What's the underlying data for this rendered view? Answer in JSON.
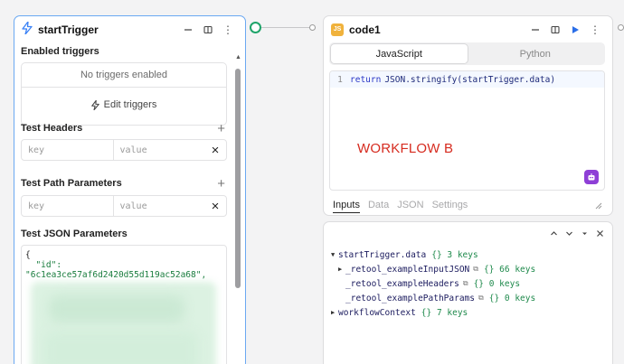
{
  "trigger_block": {
    "title": "startTrigger",
    "enabled_triggers_label": "Enabled triggers",
    "no_triggers_text": "No triggers enabled",
    "edit_triggers_label": "Edit triggers",
    "test_headers_label": "Test Headers",
    "headers_key_placeholder": "key",
    "headers_value_placeholder": "value",
    "test_path_params_label": "Test Path Parameters",
    "path_key_placeholder": "key",
    "path_value_placeholder": "value",
    "test_json_params_label": "Test JSON Parameters",
    "json_lines": [
      "{",
      "  \"id\":",
      "\"6c1ea3ce57af6d2420d55d119ac52a68\","
    ]
  },
  "code_block": {
    "title": "code1",
    "badge": "JS",
    "tabs": [
      "JavaScript",
      "Python"
    ],
    "active_tab": "JavaScript",
    "line_number": "1",
    "code_keyword": "return",
    "code_rest": "JSON.stringify(startTrigger.data)",
    "watermark": "WORKFLOW B",
    "sub_tabs": [
      "Inputs",
      "Data",
      "JSON",
      "Settings"
    ],
    "active_sub_tab": "Inputs"
  },
  "inputs_panel": {
    "tree": [
      {
        "name": "startTrigger.data",
        "meta": "{}  3 keys",
        "caret": "▼",
        "indent": 0,
        "copy": false
      },
      {
        "name": "_retool_exampleInputJSON",
        "meta": "{}  66 keys",
        "caret": "▶",
        "indent": 1,
        "copy": true
      },
      {
        "name": "_retool_exampleHeaders",
        "meta": "{}  0 keys",
        "caret": "",
        "indent": 1,
        "copy": true
      },
      {
        "name": "_retool_examplePathParams",
        "meta": "{}  0 keys",
        "caret": "",
        "indent": 1,
        "copy": true
      },
      {
        "name": "workflowContext",
        "meta": "{}  7 keys",
        "caret": "▶",
        "indent": 0,
        "copy": false
      }
    ]
  },
  "colors": {
    "accent_blue": "#6aa8f2",
    "run_blue": "#2a6ee8",
    "connector_green": "#1fa46a",
    "watermark_red": "#d62b1f",
    "assist_purple": "#8e3fd6"
  }
}
